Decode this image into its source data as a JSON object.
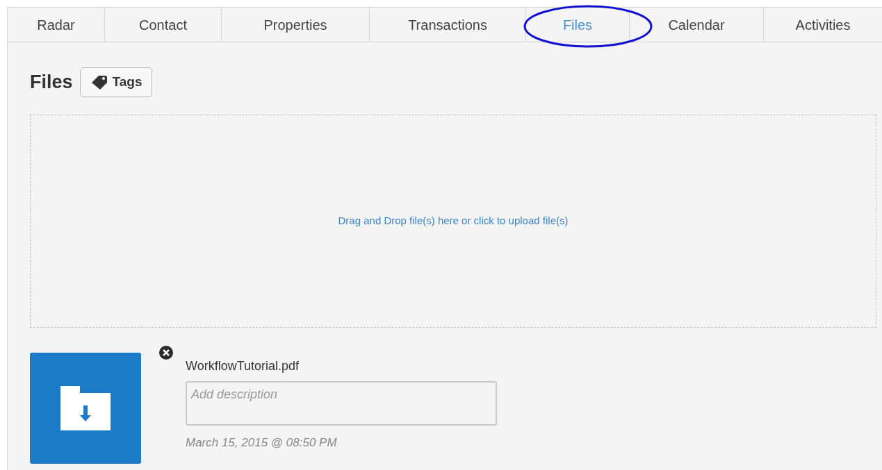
{
  "tabs": [
    {
      "label": "Radar",
      "selected": false,
      "circled": false
    },
    {
      "label": "Contact",
      "selected": false,
      "circled": false
    },
    {
      "label": "Properties",
      "selected": false,
      "circled": false
    },
    {
      "label": "Transactions",
      "selected": false,
      "circled": false
    },
    {
      "label": "Files",
      "selected": true,
      "circled": true
    },
    {
      "label": "Calendar",
      "selected": false,
      "circled": false
    },
    {
      "label": "Activities",
      "selected": false,
      "circled": false
    }
  ],
  "heading": "Files",
  "tags_button": "Tags",
  "dropzone": {
    "text": "Drag and Drop file(s) here or click to upload file(s)"
  },
  "files": [
    {
      "name": "WorkflowTutorial.pdf",
      "description_placeholder": "Add description",
      "date": "March 15, 2015 @ 08:50 PM"
    }
  ]
}
